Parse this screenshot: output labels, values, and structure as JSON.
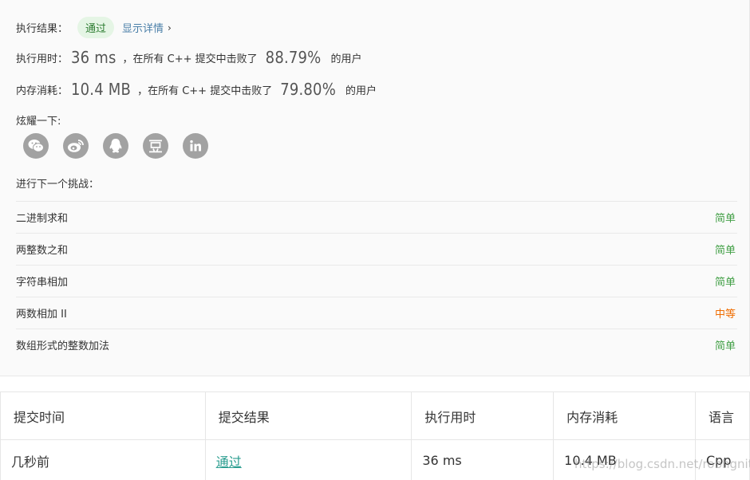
{
  "result": {
    "label": "执行结果：",
    "status": "通过",
    "details_link": "显示详情",
    "chevron": "›"
  },
  "runtime": {
    "label": "执行用时：",
    "value": "36 ms",
    "mid_text": "，在所有 C++ 提交中击败了",
    "percent": "88.79%",
    "suffix": "的用户"
  },
  "memory": {
    "label": "内存消耗：",
    "value": "10.4 MB",
    "mid_text": "，在所有 C++ 提交中击败了",
    "percent": "79.80%",
    "suffix": "的用户"
  },
  "share": {
    "label": "炫耀一下:",
    "icons": [
      "wechat-icon",
      "weibo-icon",
      "qq-icon",
      "douban-icon",
      "linkedin-icon"
    ]
  },
  "next": {
    "label": "进行下一个挑战：",
    "items": [
      {
        "title": "二进制求和",
        "difficulty": "简单",
        "color": "#43a047"
      },
      {
        "title": "两整数之和",
        "difficulty": "简单",
        "color": "#43a047"
      },
      {
        "title": "字符串相加",
        "difficulty": "简单",
        "color": "#43a047"
      },
      {
        "title": "两数相加 II",
        "difficulty": "中等",
        "color": "#ef6c00"
      },
      {
        "title": "数组形式的整数加法",
        "difficulty": "简单",
        "color": "#43a047"
      }
    ]
  },
  "submissions": {
    "headers": [
      "提交时间",
      "提交结果",
      "执行用时",
      "内存消耗",
      "语言"
    ],
    "rows": [
      {
        "time": "几秒前",
        "result": "通过",
        "runtime": "36 ms",
        "memory": "10.4 MB",
        "language": "Cpp"
      }
    ]
  },
  "watermark": "https://blog.csdn.net/robhgnit"
}
